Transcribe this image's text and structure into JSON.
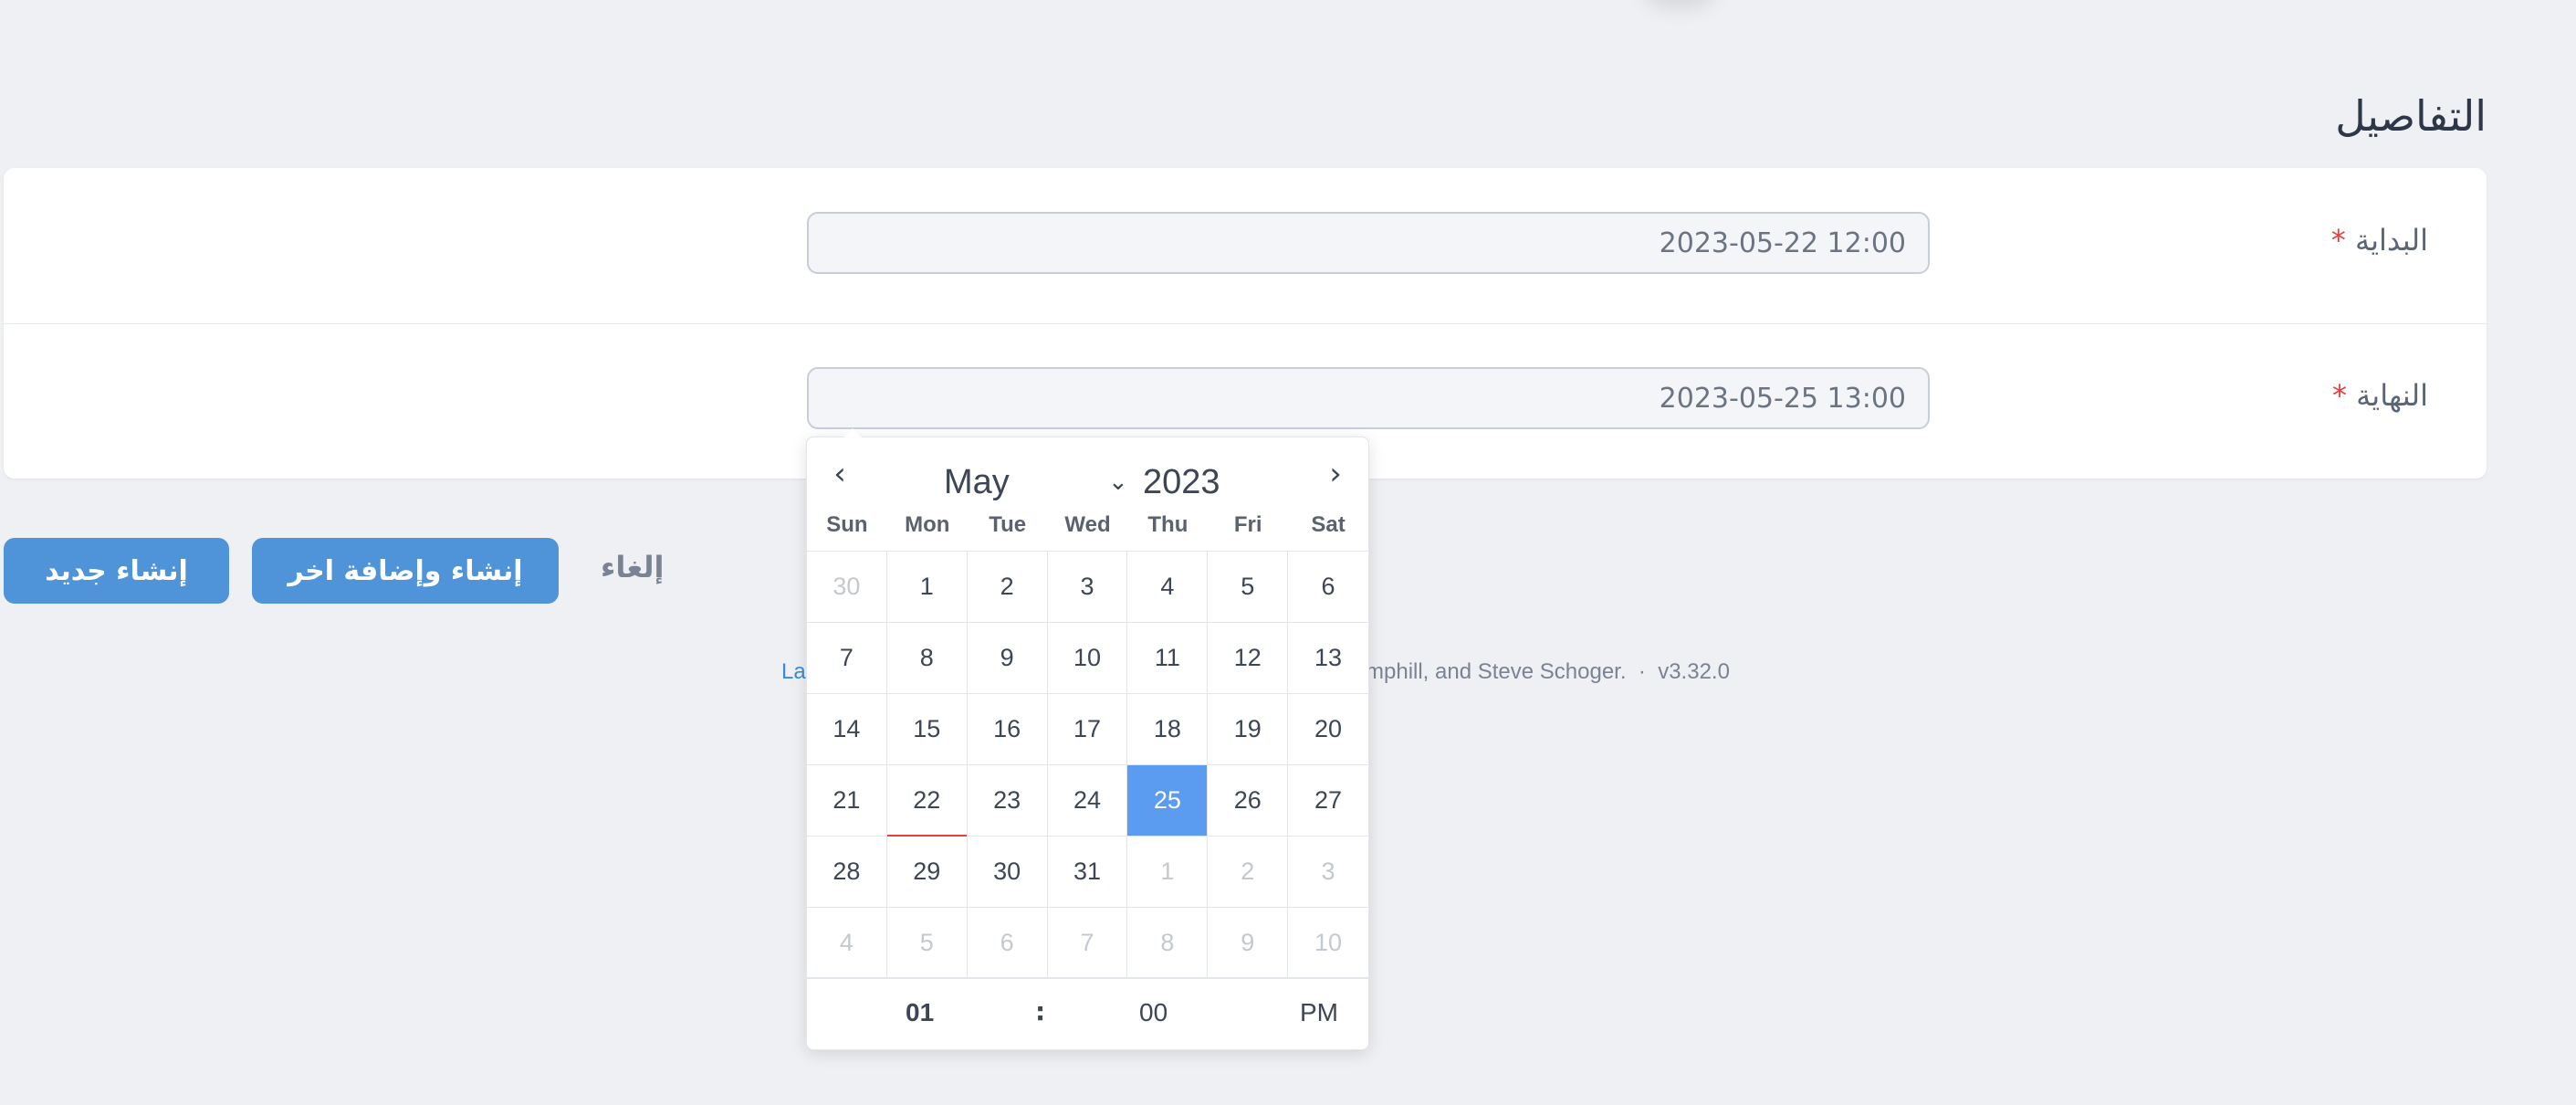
{
  "heading": "التفاصيل",
  "fields": {
    "start": {
      "label": "البداية",
      "required": "*",
      "value": "2023-05-22 12:00"
    },
    "end": {
      "label": "النهاية",
      "required": "*",
      "value": "2023-05-25 13:00"
    }
  },
  "actions": {
    "create": "إنشاء جديد",
    "create_add": "إنشاء وإضافة اخر",
    "cancel": "إلغاء"
  },
  "footer": {
    "link_fragment": "La",
    "credits_fragment": "mphill, and Steve Schoger.",
    "separator": "·",
    "version": "v3.32.0"
  },
  "calendar": {
    "month": "May",
    "year": "2023",
    "prev_icon": "chevron-left-icon",
    "next_icon": "chevron-right-icon",
    "weekdays": [
      "Sun",
      "Mon",
      "Tue",
      "Wed",
      "Thu",
      "Fri",
      "Sat"
    ],
    "days": [
      {
        "d": "30",
        "state": "muted"
      },
      {
        "d": "1"
      },
      {
        "d": "2"
      },
      {
        "d": "3"
      },
      {
        "d": "4"
      },
      {
        "d": "5"
      },
      {
        "d": "6"
      },
      {
        "d": "7"
      },
      {
        "d": "8"
      },
      {
        "d": "9"
      },
      {
        "d": "10"
      },
      {
        "d": "11"
      },
      {
        "d": "12"
      },
      {
        "d": "13"
      },
      {
        "d": "14"
      },
      {
        "d": "15"
      },
      {
        "d": "16"
      },
      {
        "d": "17"
      },
      {
        "d": "18"
      },
      {
        "d": "19"
      },
      {
        "d": "20"
      },
      {
        "d": "21"
      },
      {
        "d": "22",
        "state": "today"
      },
      {
        "d": "23"
      },
      {
        "d": "24"
      },
      {
        "d": "25",
        "state": "selected"
      },
      {
        "d": "26"
      },
      {
        "d": "27"
      },
      {
        "d": "28"
      },
      {
        "d": "29"
      },
      {
        "d": "30"
      },
      {
        "d": "31"
      },
      {
        "d": "1",
        "state": "muted"
      },
      {
        "d": "2",
        "state": "muted"
      },
      {
        "d": "3",
        "state": "muted"
      },
      {
        "d": "4",
        "state": "muted"
      },
      {
        "d": "5",
        "state": "muted"
      },
      {
        "d": "6",
        "state": "muted"
      },
      {
        "d": "7",
        "state": "muted"
      },
      {
        "d": "8",
        "state": "muted"
      },
      {
        "d": "9",
        "state": "muted"
      },
      {
        "d": "10",
        "state": "muted"
      }
    ],
    "time": {
      "hour": "01",
      "separator": ":",
      "minute": "00",
      "ampm": "PM"
    }
  },
  "colors": {
    "accent": "#4f93d8",
    "selected_day": "#5b9cf0",
    "required": "#e53e3e",
    "background": "#eef0f4"
  }
}
